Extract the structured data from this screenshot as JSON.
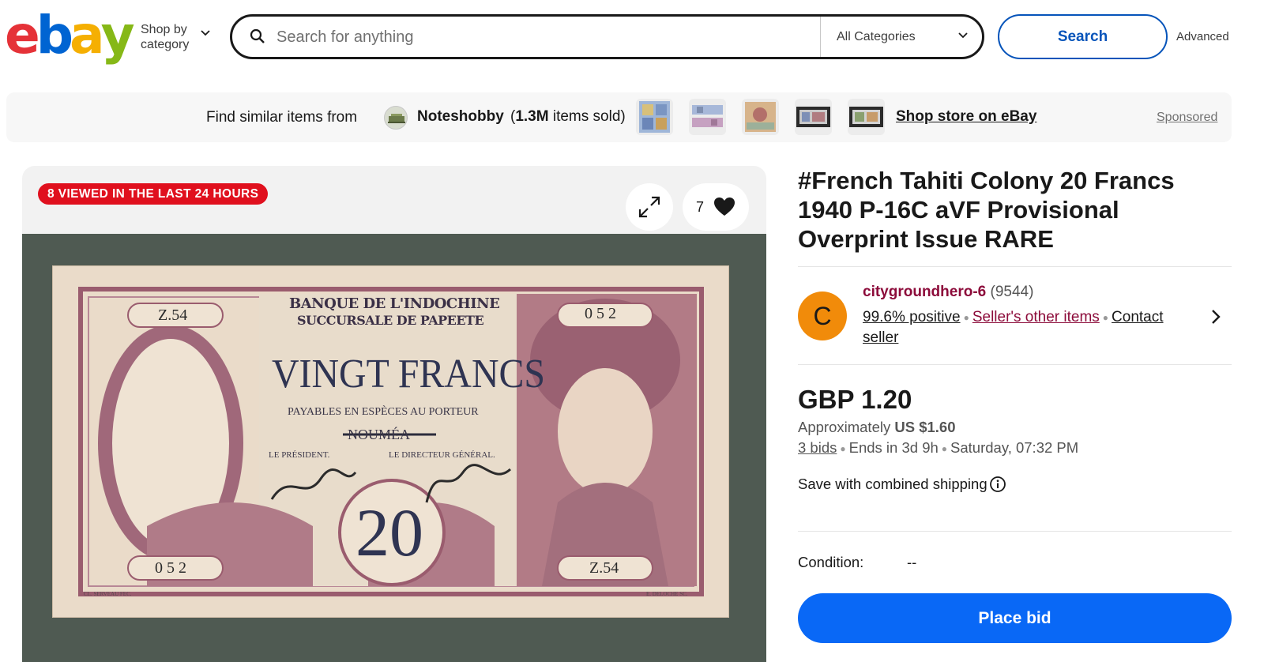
{
  "header": {
    "logo_letters": [
      {
        "ch": "e",
        "color": "#e53238"
      },
      {
        "ch": "b",
        "color": "#0064d2"
      },
      {
        "ch": "a",
        "color": "#f5af02"
      },
      {
        "ch": "y",
        "color": "#86b817"
      }
    ],
    "shop_by_line1": "Shop by",
    "shop_by_line2": "category",
    "search_placeholder": "Search for anything",
    "category_selected": "All Categories",
    "search_button": "Search",
    "advanced_link": "Advanced"
  },
  "banner": {
    "find_text": "Find similar items from",
    "store_name": "Noteshobby",
    "sold_open": "(",
    "sold_count": "1.3M",
    "sold_rest": " items sold)",
    "shop_store_link": "Shop store on eBay",
    "sponsored": "Sponsored"
  },
  "gallery": {
    "viewed_badge": "8 VIEWED IN THE LAST 24 HOURS",
    "watch_count": "7"
  },
  "banknote": {
    "bank_line1": "BANQUE DE L'INDOCHINE",
    "bank_line2": "SUCCURSALE DE PAPEETE",
    "denomination_words": "VINGT FRANCS",
    "payable": "PAYABLES EN ESPÈCES AU PORTEUR",
    "crossed_city": "NOUMÉA",
    "president": "LE PRÉSIDENT.",
    "director": "LE DIRECTEUR GÉNÉRAL.",
    "number": "20",
    "serial_left_top": "Z.54",
    "serial_right_top": "0 5 2",
    "serial_left_bottom": "0 5 2",
    "serial_right_bottom": "Z.54",
    "engraver_left": "CL. SERVEAU FEC.",
    "engraver_right": "E. DELOCHE SC."
  },
  "listing": {
    "title": "#French Tahiti Colony 20 Francs 1940 P-16C aVF Provisional Overprint Issue RARE",
    "seller": {
      "avatar_letter": "C",
      "name": "citygroundhero-6",
      "feedback": "(9544)",
      "positive": "99.6% positive",
      "other_items": "Seller's other items",
      "contact": "Contact seller"
    },
    "price": "GBP 1.20",
    "approx_label": "Approximately",
    "approx_value": "US $1.60",
    "bids": "3 bids",
    "ends_in": "Ends in 3d 9h",
    "end_time": "Saturday, 07:32 PM",
    "save_shipping": "Save with combined shipping",
    "condition_label": "Condition:",
    "condition_value": "--",
    "place_bid": "Place bid"
  },
  "colors": {
    "ebay_blue": "#0654ba",
    "bid_button": "#0968f6",
    "badge_red": "#e0101e",
    "seller_link": "#8c0b3a",
    "avatar_orange": "#f18b0a"
  }
}
